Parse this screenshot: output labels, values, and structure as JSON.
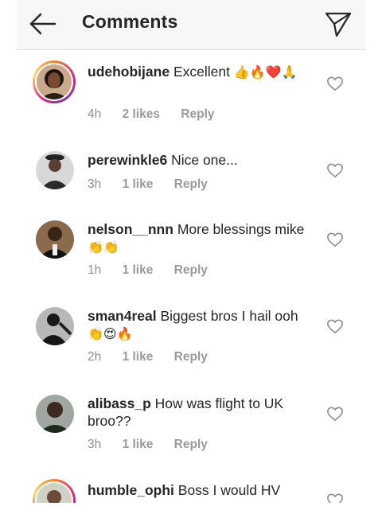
{
  "header": {
    "title": "Comments"
  },
  "comments": [
    {
      "user": "udehobijane",
      "text": "Excellent",
      "emoji": "👍🔥❤️🙏",
      "time": "4h",
      "likes": "2 likes",
      "reply": "Reply"
    },
    {
      "user": "perewinkle6",
      "text": "Nice one...",
      "emoji": "",
      "time": "3h",
      "likes": "1 like",
      "reply": "Reply"
    },
    {
      "user": "nelson__nnn",
      "text": "More blessings mike",
      "emoji": "👏👏",
      "time": "1h",
      "likes": "1 like",
      "reply": "Reply"
    },
    {
      "user": "sman4real",
      "text": "Biggest bros I hail ooh",
      "emoji": "👏😍🔥",
      "time": "2h",
      "likes": "1 like",
      "reply": "Reply"
    },
    {
      "user": "alibass_p",
      "text": "How was flight to UK broo??",
      "emoji": "",
      "time": "3h",
      "likes": "1 like",
      "reply": "Reply"
    },
    {
      "user": "humble_ophi",
      "text": "Boss I would HV",
      "emoji": "",
      "time": "",
      "likes": "",
      "reply": ""
    }
  ],
  "icons": {
    "back": "arrow-left-icon",
    "send": "paper-plane-icon",
    "like": "heart-outline-icon"
  }
}
